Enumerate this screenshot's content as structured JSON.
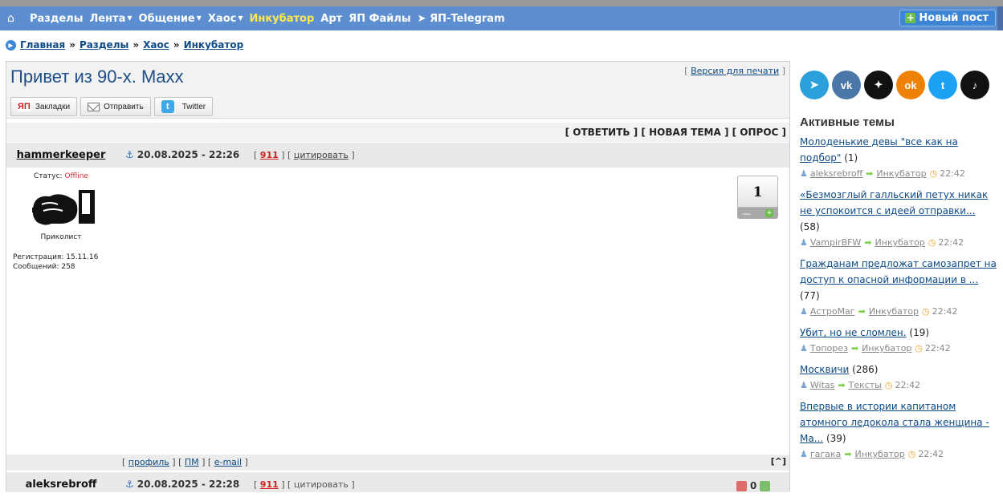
{
  "nav": {
    "home_icon": "home-icon",
    "items": [
      {
        "label": "Разделы",
        "caret": false,
        "active": false
      },
      {
        "label": "Лента",
        "caret": true,
        "active": false
      },
      {
        "label": "Общение",
        "caret": true,
        "active": false
      },
      {
        "label": "Хаос",
        "caret": true,
        "active": false
      },
      {
        "label": "Инкубатор",
        "caret": false,
        "active": true
      },
      {
        "label": "Арт",
        "caret": false,
        "active": false
      },
      {
        "label": "ЯП Файлы",
        "caret": false,
        "active": false
      },
      {
        "label": "ЯП-Telegram",
        "caret": false,
        "active": false
      }
    ],
    "new_post": "Новый пост",
    "colors": {
      "bar": "#5d8fd0",
      "active": "#ffe94a"
    }
  },
  "breadcrumb": {
    "items": [
      "Главная",
      "Разделы",
      "Хаос",
      "Инкубатор"
    ],
    "sep": "»"
  },
  "topic": {
    "title": "Привет из 90-х. Maxx",
    "print_version": "Версия для печати",
    "share": {
      "bookmarks": "Закладки",
      "bookmarks_logo": "ЯП",
      "send": "Отправить",
      "twitter": "Twitter"
    },
    "actions": [
      "[ ОТВЕТИТЬ ]",
      "[ НОВАЯ ТЕМА ]",
      "[ ОПРОС ]"
    ]
  },
  "post1": {
    "author": "hammerkeeper",
    "date": "20.08.2025 - 22:26",
    "number": "911",
    "quote": "цитировать",
    "status_label": "Статус:",
    "status": "Offline",
    "rank": "Приколист",
    "registration": "Регистрация: 15.11.16",
    "messages": "Сообщений: 258",
    "rating": "1",
    "foot": {
      "profile": "профиль",
      "pm": "ПМ",
      "email": "e-mail",
      "top": "[^]"
    }
  },
  "post2": {
    "author": "aleksrebroff",
    "date": "20.08.2025 - 22:28",
    "number": "911",
    "quote": "цитировать",
    "votes": "0"
  },
  "sidebar": {
    "social": [
      {
        "name": "telegram-icon",
        "glyph": "➤"
      },
      {
        "name": "vk-icon",
        "glyph": "vk"
      },
      {
        "name": "dzen-icon",
        "glyph": "✦"
      },
      {
        "name": "ok-icon",
        "glyph": "ok"
      },
      {
        "name": "twitter-icon",
        "glyph": "t"
      },
      {
        "name": "tiktok-icon",
        "glyph": "♪"
      }
    ],
    "active_title": "Активные темы",
    "topics": [
      {
        "title": "Молоденькие девы \"все как на подбор\"",
        "count": "(1)",
        "user": "aleksrebroff",
        "section": "Инкубатор",
        "time": "22:42"
      },
      {
        "title": "«Безмозглый галльский петух никак не успокоится с идеей отправки...",
        "count": "(58)",
        "user": "VampirBFW",
        "section": "Инкубатор",
        "time": "22:42"
      },
      {
        "title": "Гражданам предложат самозапрет на доступ к опасной информации в ...",
        "count": "(77)",
        "user": "АстроМаг",
        "section": "Инкубатор",
        "time": "22:42"
      },
      {
        "title": "Убит, но не сломлен.",
        "count": "(19)",
        "user": "Топорез",
        "section": "Инкубатор",
        "time": "22:42"
      },
      {
        "title": "Москвичи",
        "count": "(286)",
        "user": "Witas",
        "section": "Тексты",
        "time": "22:42"
      },
      {
        "title": "Впервые в истории капитаном атомного ледокола стала женщина - Ма...",
        "count": "(39)",
        "user": "гагака",
        "section": "Инкубатор",
        "time": "22:42"
      }
    ]
  }
}
